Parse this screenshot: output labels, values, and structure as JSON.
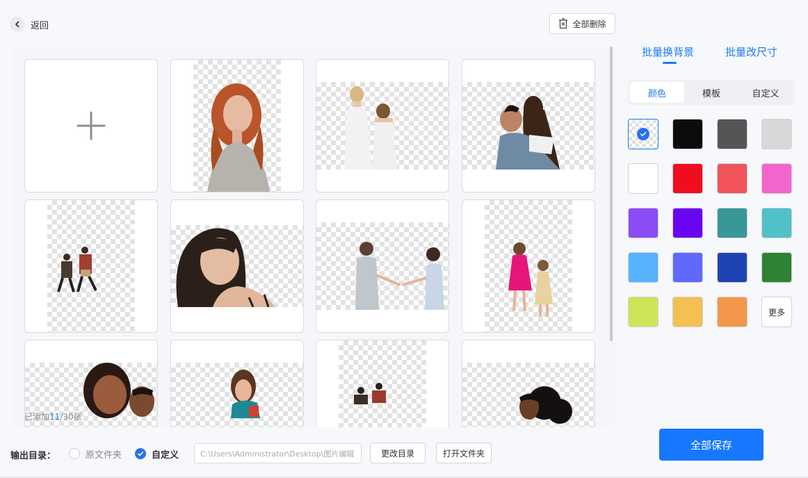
{
  "header": {
    "back_label": "返回",
    "delete_all_label": "全部删除"
  },
  "gallery": {
    "add_label": "+",
    "count_prefix": "已添加",
    "count_added": "11",
    "count_total": "/30张",
    "images": [
      {
        "subject": "woman-red-hair"
      },
      {
        "subject": "mother-and-daughter"
      },
      {
        "subject": "couple-hug"
      },
      {
        "subject": "hikers-walking"
      },
      {
        "subject": "woman-portrait"
      },
      {
        "subject": "two-girls-holding-hands"
      },
      {
        "subject": "little-girls-pink-dress"
      },
      {
        "subject": "smiling-couple"
      },
      {
        "subject": "woman-scarf"
      },
      {
        "subject": "walking-people"
      },
      {
        "subject": "man-curly-hair"
      }
    ]
  },
  "panel": {
    "tabs": [
      {
        "label": "批量换背景"
      },
      {
        "label": "批量改尺寸"
      }
    ],
    "subtabs": [
      {
        "label": "颜色"
      },
      {
        "label": "模板"
      },
      {
        "label": "自定义"
      }
    ],
    "colors": [
      "transparent",
      "#0c0c0c",
      "#555555",
      "#d8d8d8",
      "#ffffff",
      "#ef0d1e",
      "#f0545a",
      "#f265cc",
      "#8b4cf6",
      "#6a05f1",
      "#3a9798",
      "#52c0c8",
      "#57b2ff",
      "#6068fd",
      "#2043b4",
      "#2d8331",
      "#cde457",
      "#f4c052",
      "#f49649"
    ],
    "more_label": "更多",
    "accent": "#1a7cf5"
  },
  "footer": {
    "output_label": "输出目录：",
    "option_original": "原文件夹",
    "option_custom": "自定义",
    "path_value": "C:\\Users\\Administrator\\Desktop\\图片编辑",
    "change_dir_label": "更改目录",
    "open_folder_label": "打开文件夹",
    "save_all_label": "全部保存"
  }
}
